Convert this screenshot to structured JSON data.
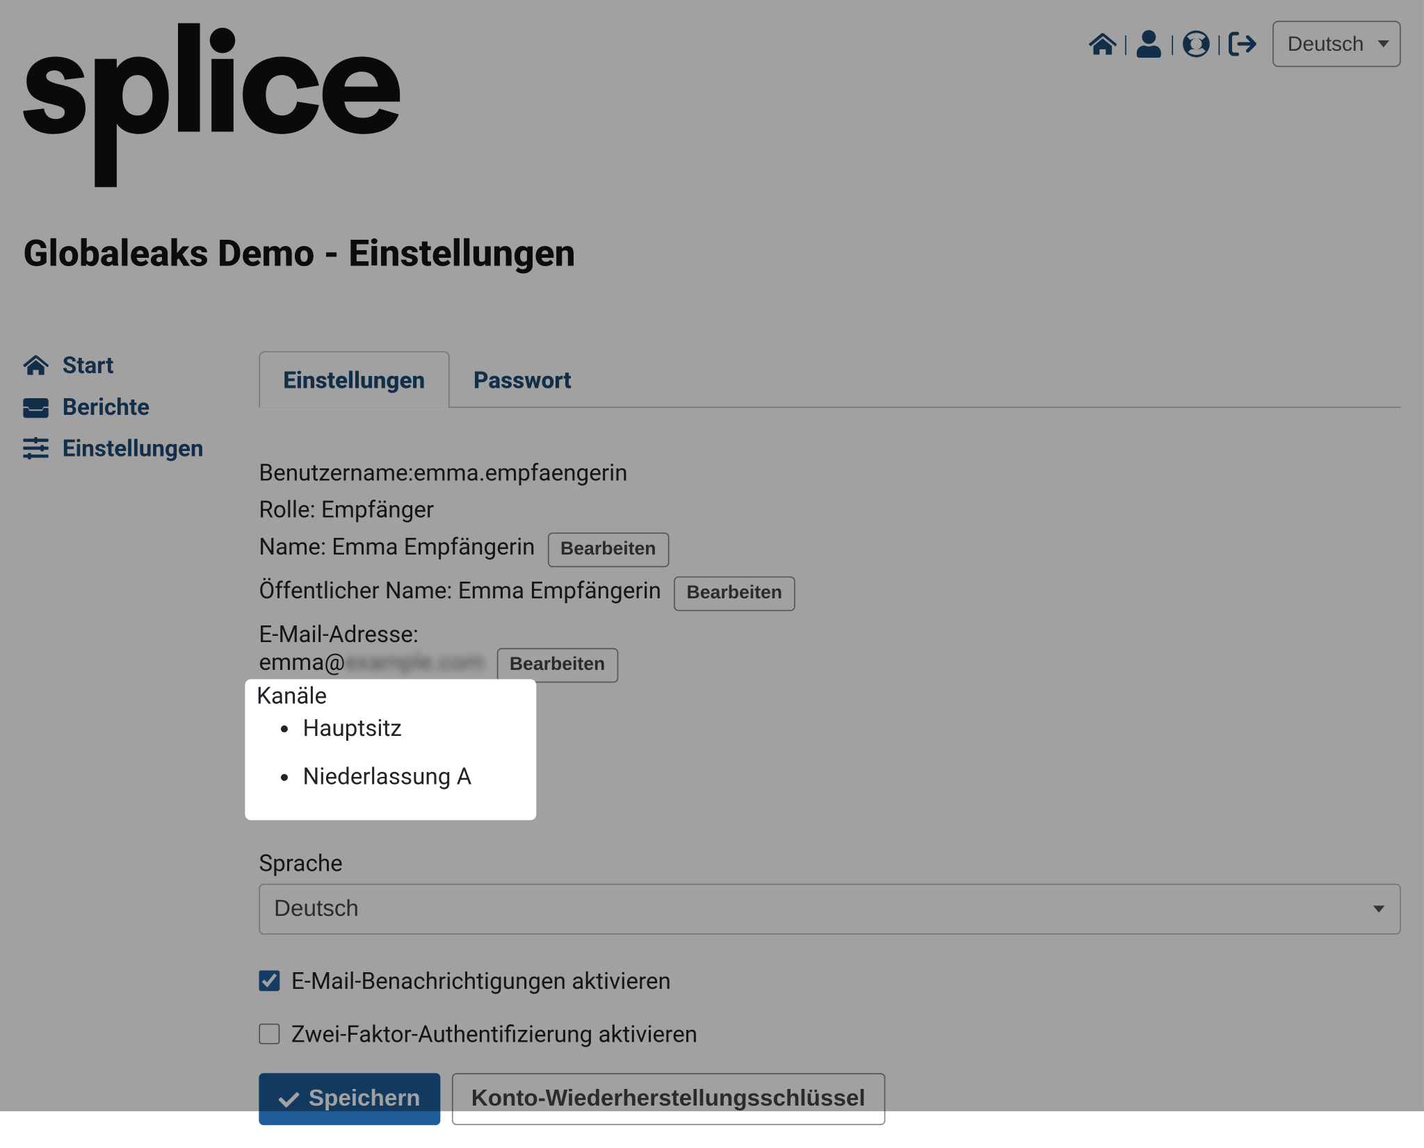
{
  "topnav": {
    "language_selected": "Deutsch"
  },
  "page_title": "Globaleaks Demo - Einstellungen",
  "sidebar": {
    "items": [
      {
        "label": "Start"
      },
      {
        "label": "Berichte"
      },
      {
        "label": "Einstellungen"
      }
    ]
  },
  "tabs": [
    {
      "label": "Einstellungen",
      "active": true
    },
    {
      "label": "Passwort",
      "active": false
    }
  ],
  "fields": {
    "username_label": "Benutzername:",
    "username_value": "emma.empfaengerin",
    "role_label": "Rolle:",
    "role_value": "Empfänger",
    "name_label": "Name:",
    "name_value": "Emma Empfängerin",
    "public_name_label": "Öffentlicher Name:",
    "public_name_value": "Emma Empfängerin",
    "email_label": "E-Mail-Adresse:",
    "email_value": "emma@",
    "edit_button": "Bearbeiten"
  },
  "channels": {
    "label": "Kanäle",
    "items": [
      "Hauptsitz",
      "Niederlassung A"
    ]
  },
  "language": {
    "label": "Sprache",
    "selected": "Deutsch"
  },
  "checks": {
    "email_notifications": "E-Mail-Benachrichtigungen aktivieren",
    "twofa": "Zwei-Faktor-Authentifizierung aktivieren"
  },
  "actions": {
    "save": "Speichern",
    "recovery": "Konto-Wiederherstellungsschlüssel"
  }
}
